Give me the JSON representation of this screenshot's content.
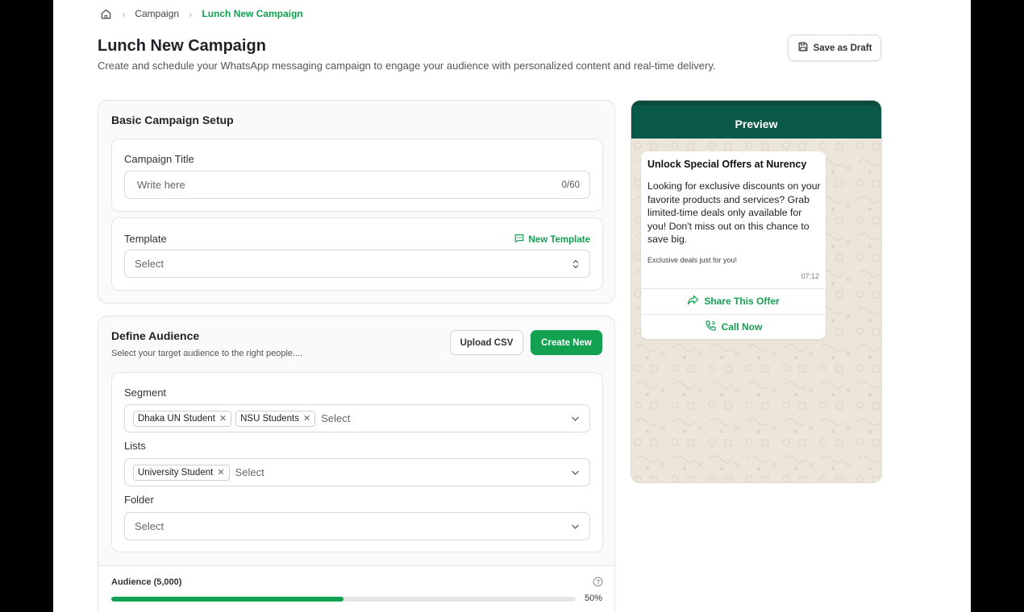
{
  "breadcrumb": {
    "items": [
      "Campaign",
      "Lunch New Campaign"
    ]
  },
  "header": {
    "title": "Lunch New Campaign",
    "subtitle": "Create and schedule your WhatsApp messaging campaign to engage your audience with personalized content and real-time delivery.",
    "save_draft_label": "Save as Draft"
  },
  "setup": {
    "title": "Basic Campaign Setup",
    "campaign_title_label": "Campaign Title",
    "campaign_title_placeholder": "Write here",
    "campaign_title_counter": "0/60",
    "template_label": "Template",
    "new_template_label": "New Template",
    "template_placeholder": "Select"
  },
  "audience": {
    "title": "Define Audience",
    "subtitle": "Select your target audience to the right people....",
    "upload_label": "Upload CSV",
    "create_label": "Create New",
    "segment_label": "Segment",
    "segment_chips": [
      "Dhaka UN Student",
      "NSU Students"
    ],
    "segment_placeholder": "Select",
    "lists_label": "Lists",
    "lists_chips": [
      "University Student"
    ],
    "lists_placeholder": "Select",
    "folder_label": "Folder",
    "folder_placeholder": "Select",
    "audience_count_label": "Audience (5,000)",
    "progress_percent": 50,
    "progress_text": "50%"
  },
  "preview": {
    "title": "Preview",
    "message_title": "Unlock Special Offers at Nurency",
    "message_body": "Looking for exclusive discounts on your favorite products and services? Grab limited-time deals only available for you! Don't miss out on this chance to save big.",
    "message_footer": "Exclusive deals just for you!",
    "message_time": "07:12",
    "action_share": "Share This Offer",
    "action_call": "Call Now"
  },
  "colors": {
    "accent": "#12a150",
    "preview_header": "#0a5847",
    "preview_bg": "#ece5da"
  }
}
